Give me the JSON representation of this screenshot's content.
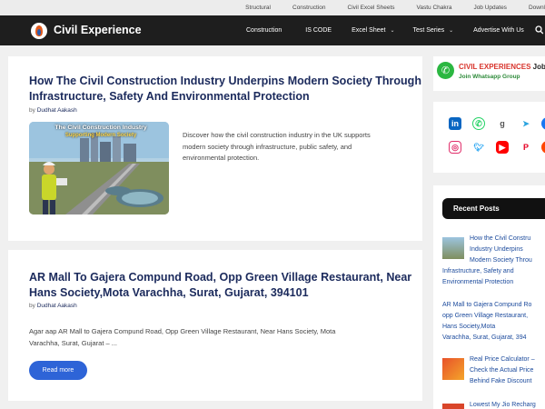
{
  "topbar": {
    "links": [
      "Structural",
      "Construction",
      "Civil Excel Sheets",
      "Vastu Chakra",
      "Job Updates",
      "Downl"
    ]
  },
  "header": {
    "site_title": "Civil Experience",
    "nav": [
      {
        "label": "Construction",
        "has_dropdown": false
      },
      {
        "label": "IS CODE",
        "has_dropdown": false
      },
      {
        "label": "Excel Sheet",
        "has_dropdown": true
      },
      {
        "label": "Test Series",
        "has_dropdown": true
      },
      {
        "label": "Advertise With Us",
        "has_dropdown": false
      }
    ],
    "search_icon": "search-icon"
  },
  "posts": [
    {
      "title_line1": "How The Civil Construction Industry Underpins Modern Society Through",
      "title_line2": "Infrastructure, Safety And Environmental Protection",
      "by": "by",
      "author": "Dudhat Aakash",
      "thumb_title": "The Civil Construction Industry",
      "thumb_subtitle": "Supporting Modern Society",
      "excerpt_lines": [
        "Discover how the civil construction industry in the UK supports",
        "modern society through infrastructure, public safety, and",
        "environmental protection."
      ]
    },
    {
      "title_line1": "AR Mall To Gajera Compund Road, Opp Green Village Restaurant, Near",
      "title_line2": "Hans Society,Mota Varachha, Surat, Gujarat, 394101",
      "by": "by",
      "author": "Dudhat Aakash",
      "excerpt_lines": [
        "Agar aap AR Mall to Gajera Compund Road, Opp Green Village Restaurant, Near Hans Society, Mota",
        "Varachha, Surat, Gujarat – ..."
      ],
      "read_more": "Read more"
    }
  ],
  "sidebar": {
    "whatsapp": {
      "line1": "CIVIL EXPERIENCES",
      "line1_suffix": "Job",
      "line2": "Join Whatsapp Group"
    },
    "social_icons": [
      "linkedin-icon",
      "whatsapp-icon",
      "goodreads-icon",
      "telegram-icon",
      "facebook-icon",
      "instagram-icon",
      "twitter-icon",
      "youtube-icon",
      "pinterest-icon",
      "reddit-icon"
    ],
    "recent_title": "Recent Posts",
    "recent_posts": [
      {
        "lines": [
          "How the Civil Constru",
          "Industry Underpins",
          "Modern Society Throu",
          "Infrastructure, Safety and",
          "Environmental Protection"
        ]
      },
      {
        "lines": [
          "AR Mall to Gajera Compund Ro",
          "opp Green Village Restaurant,",
          "Hans Society,Mota",
          "Varachha, Surat, Gujarat, 394"
        ]
      },
      {
        "lines": [
          "Real Price Calculator –",
          "Check the Actual Price",
          "Behind Fake Discount"
        ]
      },
      {
        "lines": [
          "Lowest My Jio Recharg"
        ]
      }
    ]
  },
  "colors": {
    "header_bg": "#1e1e1e",
    "title_color": "#1b2a5c",
    "button_blue": "#2e64d7",
    "link_blue": "#1b4a9c"
  }
}
